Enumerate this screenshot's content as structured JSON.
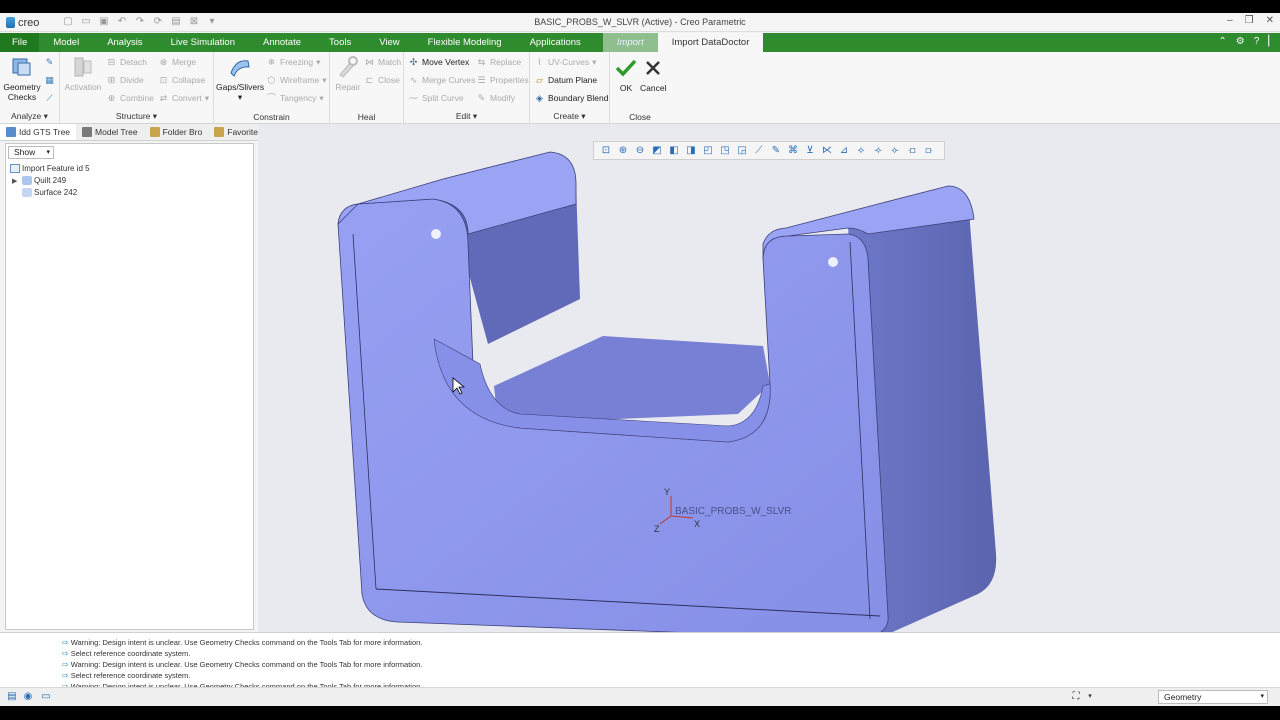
{
  "window": {
    "app_logo": "creo",
    "title": "BASIC_PROBS_W_SLVR (Active) - Creo Parametric"
  },
  "tabs": [
    "File",
    "Model",
    "Analysis",
    "Live Simulation",
    "Annotate",
    "Tools",
    "View",
    "Flexible Modeling",
    "Applications",
    "Import",
    "Import DataDoctor"
  ],
  "ribbon": {
    "analyze": {
      "label": "Analyze",
      "geometry_checks": "Geometry Checks"
    },
    "structure": {
      "label": "Structure",
      "activation": "Activation",
      "detach": "Detach",
      "divide": "Divide",
      "combine": "Combine",
      "merge": "Merge",
      "collapse": "Collapse",
      "convert": "Convert"
    },
    "constrain": {
      "label": "Constrain",
      "gaps_slivers": "Gaps/Slivers",
      "freezing": "Freezing",
      "wireframe": "Wireframe",
      "tangency": "Tangency"
    },
    "heal": {
      "label": "Heal",
      "repair": "Repair",
      "match": "Match",
      "close": "Close"
    },
    "edit": {
      "label": "Edit",
      "move_vertex": "Move Vertex",
      "merge_curves": "Merge Curves",
      "split_curve": "Split Curve",
      "replace": "Replace",
      "properties": "Properties",
      "modify": "Modify"
    },
    "create": {
      "label": "Create",
      "uv_curves": "UV-Curves",
      "datum_plane": "Datum Plane",
      "boundary_blend": "Boundary Blend"
    },
    "close_group": {
      "label": "Close",
      "ok": "OK",
      "cancel": "Cancel"
    }
  },
  "navigator": {
    "tabs": [
      "Idd GTS Tree",
      "Model Tree",
      "Folder Bro",
      "Favorites"
    ],
    "show": "Show",
    "tree": [
      "Import Feature id 5",
      "Quilt 249",
      "Surface 242"
    ]
  },
  "viewport": {
    "csys_name": "BASIC_PROBS_W_SLVR",
    "axis_x": "X",
    "axis_y": "Y",
    "axis_z": "Z",
    "model_color": "#8f98ee"
  },
  "messages": [
    "Warning: Design intent is unclear. Use Geometry Checks command on the Tools Tab for more information.",
    "Select reference coordinate system.",
    "Warning: Design intent is unclear. Use Geometry Checks command on the Tools Tab for more information.",
    "Select reference coordinate system.",
    "Warning: Design intent is unclear. Use Geometry Checks command on the Tools Tab for more information."
  ],
  "status": {
    "filter_value": "Geometry"
  },
  "colors": {
    "ribbon_green": "#2e8b2e",
    "ok_green": "#2e9a2e"
  }
}
